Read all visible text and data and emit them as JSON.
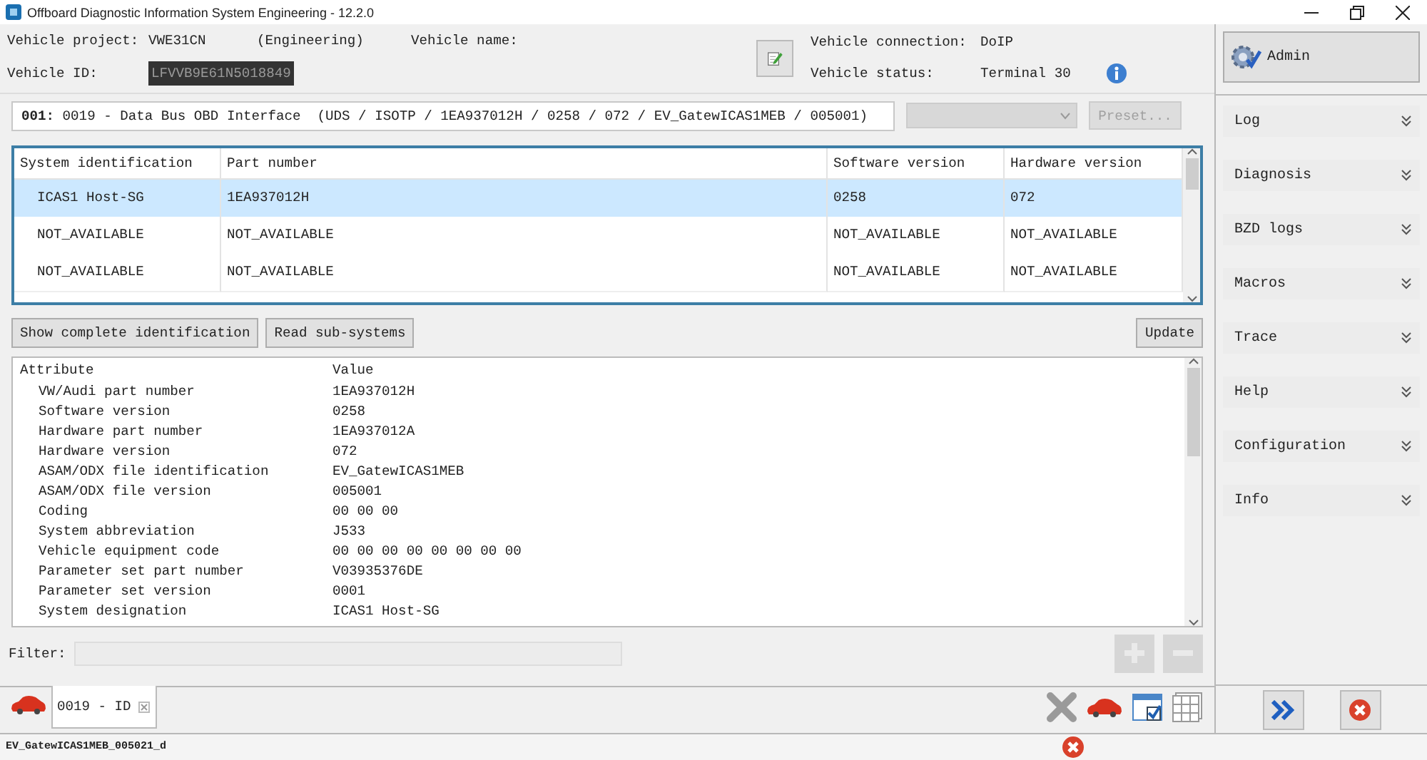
{
  "window": {
    "title": "Offboard Diagnostic Information System Engineering - 12.2.0"
  },
  "vehicle_info": {
    "project_label": "Vehicle project:",
    "project": "VWE31CN",
    "mode": "(Engineering)",
    "name_label": "Vehicle name:",
    "id_label": "Vehicle ID:",
    "id": "LFVVB9E61N5018849",
    "connection_label": "Vehicle connection:",
    "connection": "DoIP",
    "status_label": "Vehicle status:",
    "status": "Terminal 30"
  },
  "interface": {
    "index": "001:",
    "description": "0019 - Data Bus OBD Interface  (UDS / ISOTP / 1EA937012H / 0258 / 072 / EV_GatewICAS1MEB / 005001)"
  },
  "preset_button": {
    "label": "Preset...",
    "disabled": true
  },
  "systems_table": {
    "columns": [
      "System identification",
      "Part number",
      "Software version",
      "Hardware version"
    ],
    "rows": [
      {
        "cells": [
          "ICAS1 Host-SG",
          "1EA937012H",
          "0258",
          "072"
        ],
        "selected": true
      },
      {
        "cells": [
          "NOT_AVAILABLE",
          "NOT_AVAILABLE",
          "NOT_AVAILABLE",
          "NOT_AVAILABLE"
        ],
        "selected": false
      },
      {
        "cells": [
          "NOT_AVAILABLE",
          "NOT_AVAILABLE",
          "NOT_AVAILABLE",
          "NOT_AVAILABLE"
        ],
        "selected": false
      }
    ]
  },
  "action_buttons": [
    {
      "label": "Show complete identification"
    },
    {
      "label": "Read sub-systems"
    }
  ],
  "update_button": {
    "label": "Update"
  },
  "attributes_table": {
    "columns": [
      "Attribute",
      "Value"
    ],
    "rows": [
      {
        "attribute": "VW/Audi part number",
        "value": "1EA937012H"
      },
      {
        "attribute": "Software version",
        "value": "0258"
      },
      {
        "attribute": "Hardware part number",
        "value": "1EA937012A"
      },
      {
        "attribute": "Hardware version",
        "value": "072"
      },
      {
        "attribute": "ASAM/ODX file identification",
        "value": "EV_GatewICAS1MEB"
      },
      {
        "attribute": "ASAM/ODX file version",
        "value": "005001"
      },
      {
        "attribute": "Coding",
        "value": "00 00 00"
      },
      {
        "attribute": "System abbreviation",
        "value": "J533"
      },
      {
        "attribute": "Vehicle equipment code",
        "value": "00 00 00 00 00 00 00 00"
      },
      {
        "attribute": "Parameter set part number",
        "value": "V03935376DE"
      },
      {
        "attribute": "Parameter set version",
        "value": "0001"
      },
      {
        "attribute": "System designation",
        "value": "ICAS1 Host-SG"
      }
    ]
  },
  "filter": {
    "label": "Filter:"
  },
  "list_controls": [
    {
      "kind": "add",
      "disabled": true
    },
    {
      "kind": "remove",
      "disabled": true
    }
  ],
  "tabs": [
    {
      "label": "0019 - ID",
      "selected": true
    }
  ],
  "sidebar": {
    "admin_button": "Admin",
    "sections": [
      {
        "label": "Log",
        "expanded": false
      },
      {
        "label": "Diagnosis",
        "expanded": false
      },
      {
        "label": "BZD logs",
        "expanded": false
      },
      {
        "label": "Macros",
        "expanded": false
      },
      {
        "label": "Trace",
        "expanded": false
      },
      {
        "label": "Help",
        "expanded": false
      },
      {
        "label": "Configuration",
        "expanded": false
      },
      {
        "label": "Info",
        "expanded": false
      }
    ]
  },
  "status_bar": {
    "text": "EV_GatewICAS1MEB_005021_d"
  }
}
